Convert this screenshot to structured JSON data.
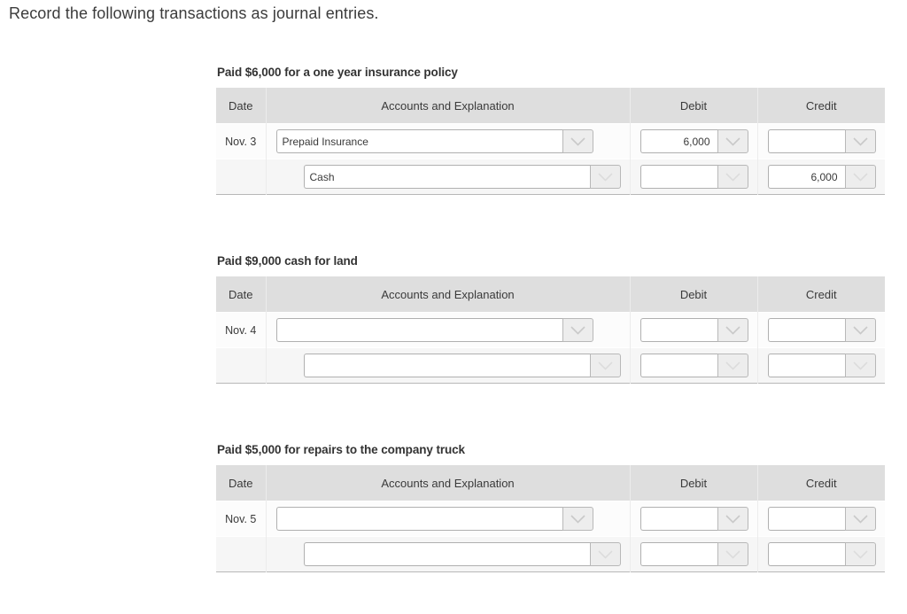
{
  "instruction": "Record the following transactions as journal entries.",
  "icons": {
    "dropdown": "chevron-down-icon"
  },
  "colors": {
    "header_bg": "#dedede",
    "row1_bg": "#fcfcfc",
    "row2_bg": "#f6f6f6",
    "text": "#3a3a3a",
    "input_border": "#b0b0b0",
    "button_bg": "#ededed",
    "table_bottom_border": "#b8b8b8"
  },
  "columns": {
    "date": "Date",
    "accounts": "Accounts and Explanation",
    "debit": "Debit",
    "credit": "Credit"
  },
  "blocks": [
    {
      "title": "Paid $6,000 for a one year insurance policy",
      "rows": [
        {
          "date": "Nov. 3",
          "account": "Prepaid Insurance",
          "debit": "6,000",
          "credit": "",
          "indent": false
        },
        {
          "date": "",
          "account": "Cash",
          "debit": "",
          "credit": "6,000",
          "indent": true
        }
      ]
    },
    {
      "title": "Paid $9,000 cash for land",
      "rows": [
        {
          "date": "Nov. 4",
          "account": "",
          "debit": "",
          "credit": "",
          "indent": false
        },
        {
          "date": "",
          "account": "",
          "debit": "",
          "credit": "",
          "indent": true
        }
      ]
    },
    {
      "title": "Paid $5,000 for repairs to the company truck",
      "rows": [
        {
          "date": "Nov. 5",
          "account": "",
          "debit": "",
          "credit": "",
          "indent": false
        },
        {
          "date": "",
          "account": "",
          "debit": "",
          "credit": "",
          "indent": true
        }
      ]
    }
  ]
}
